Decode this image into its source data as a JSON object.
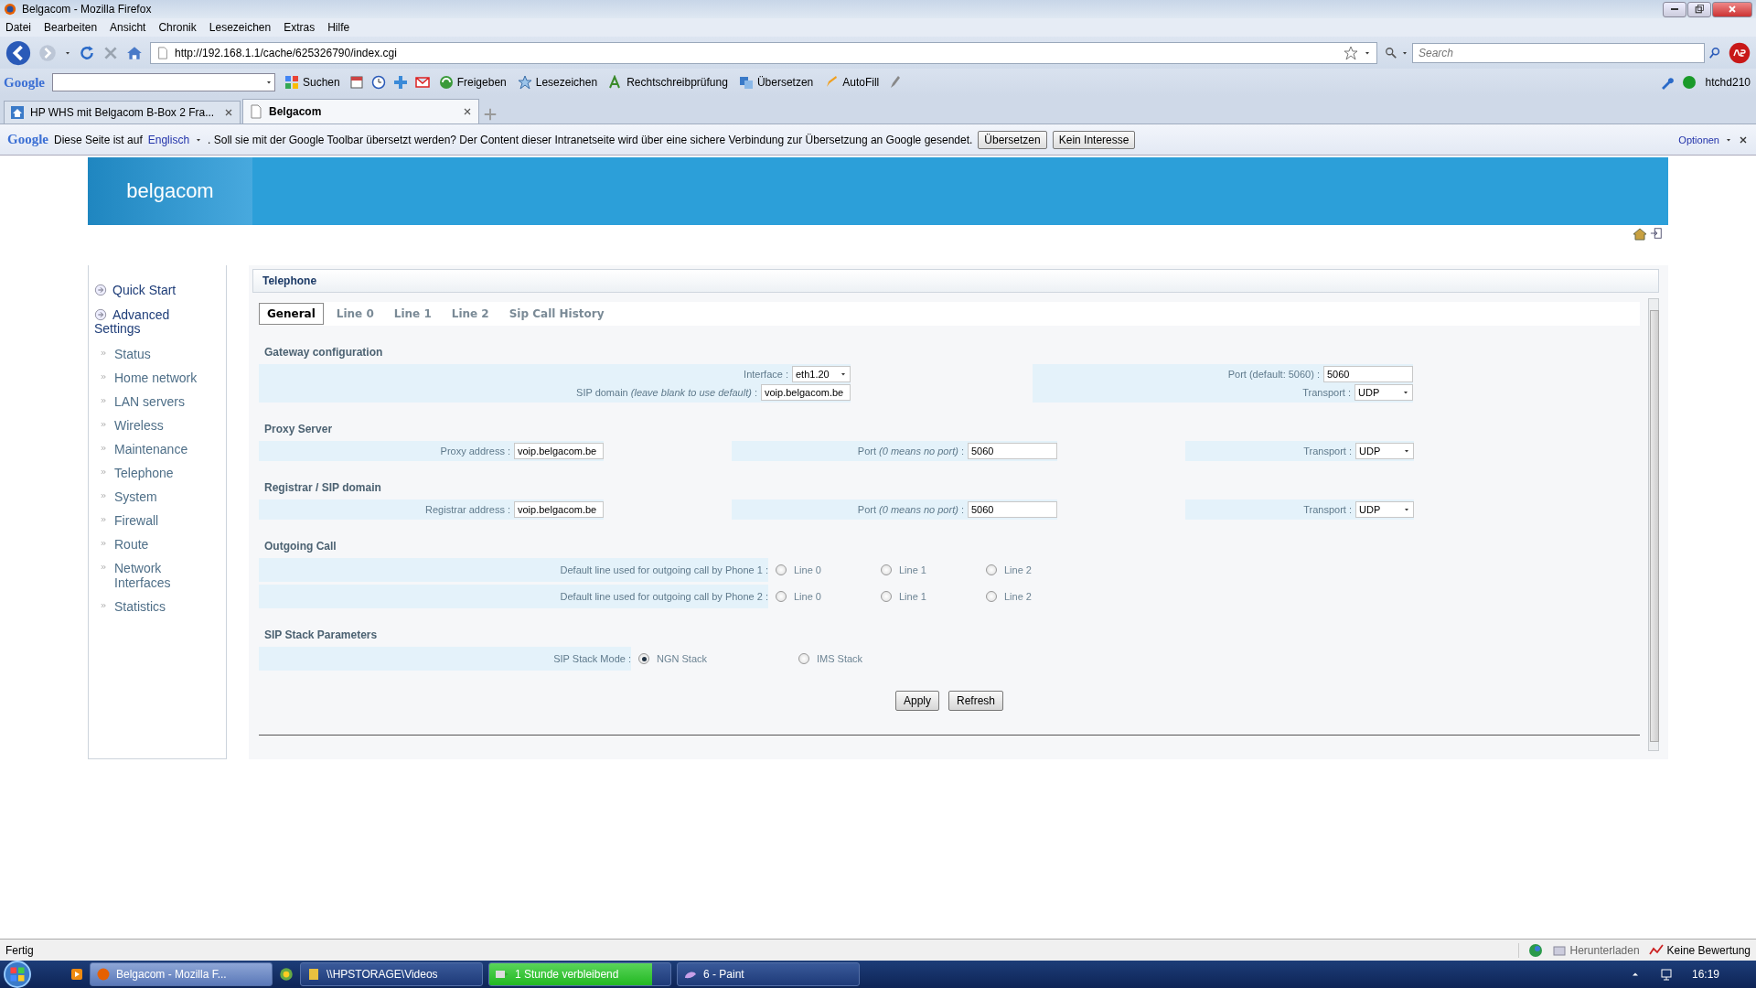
{
  "window": {
    "title": "Belgacom - Mozilla Firefox"
  },
  "menu": [
    "Datei",
    "Bearbeiten",
    "Ansicht",
    "Chronik",
    "Lesezeichen",
    "Extras",
    "Hilfe"
  ],
  "navbar": {
    "url": "http://192.168.1.1/cache/625326790/index.cgi",
    "search": {
      "placeholder": "Search"
    }
  },
  "google_toolbar": {
    "logo": "Google",
    "items": [
      "Suchen",
      "Freigeben",
      "Lesezeichen",
      "Rechtschreibprüfung",
      "Übersetzen",
      "AutoFill"
    ],
    "account": "htchd210"
  },
  "tabs": [
    {
      "label": "HP WHS mit Belgacom B-Box 2 Fra...",
      "selected": false
    },
    {
      "label": "Belgacom",
      "selected": true
    }
  ],
  "translate_bar": {
    "logo": "Google",
    "prefix": "Diese Seite ist auf",
    "language": "Englisch",
    "message": ". Soll sie mit der Google Toolbar übersetzt werden? Der Content dieser Intranetseite wird über eine sichere Verbindung zur Übersetzung an Google gesendet.",
    "buttons": [
      "Übersetzen",
      "Kein Interesse"
    ],
    "options": "Optionen"
  },
  "page": {
    "brand": "belgacom",
    "sidebar": [
      {
        "label": "Quick Start",
        "kind": "section"
      },
      {
        "label": "Advanced Settings",
        "kind": "section"
      },
      {
        "label": "Status",
        "kind": "link"
      },
      {
        "label": "Home network",
        "kind": "link"
      },
      {
        "label": "LAN servers",
        "kind": "link"
      },
      {
        "label": "Wireless",
        "kind": "link"
      },
      {
        "label": "Maintenance",
        "kind": "link"
      },
      {
        "label": "Telephone",
        "kind": "link"
      },
      {
        "label": "System",
        "kind": "link"
      },
      {
        "label": "Firewall",
        "kind": "link"
      },
      {
        "label": "Route",
        "kind": "link"
      },
      {
        "label": "Network Interfaces",
        "kind": "link"
      },
      {
        "label": "Statistics",
        "kind": "link"
      }
    ],
    "panel": {
      "title": "Telephone",
      "tabs": [
        {
          "label": "General",
          "selected": true
        },
        {
          "label": "Line 0",
          "selected": false
        },
        {
          "label": "Line 1",
          "selected": false
        },
        {
          "label": "Line 2",
          "selected": false
        },
        {
          "label": "Sip Call History",
          "selected": false
        }
      ],
      "sections": [
        {
          "title": "Gateway configuration",
          "kind": "columns",
          "columns": [
            [
              {
                "label": "Interface :",
                "kind": "select",
                "value": "eth1.20"
              },
              {
                "label": "SIP domain *(leave blank to use default)* :",
                "kind": "input",
                "value": "voip.belgacom.be"
              }
            ],
            [
              {
                "label": "Port (default: 5060) :",
                "kind": "input",
                "value": "5060"
              },
              {
                "label": "Transport :",
                "kind": "select",
                "value": "UDP"
              }
            ]
          ]
        },
        {
          "title": "Proxy Server",
          "kind": "row",
          "cells": [
            {
              "label": "Proxy address :",
              "kind": "input",
              "value": "voip.belgacom.be"
            },
            {
              "label": "Port *(0 means no port)* :",
              "kind": "input",
              "value": "5060"
            },
            {
              "label": "Transport :",
              "kind": "select",
              "value": "UDP"
            }
          ]
        },
        {
          "title": "Registrar / SIP domain",
          "kind": "row",
          "cells": [
            {
              "label": "Registrar address :",
              "kind": "input",
              "value": "voip.belgacom.be"
            },
            {
              "label": "Port *(0 means no port)* :",
              "kind": "input",
              "value": "5060"
            },
            {
              "label": "Transport :",
              "kind": "select",
              "value": "UDP"
            }
          ]
        },
        {
          "title": "Outgoing Call",
          "kind": "radios",
          "rows": [
            {
              "label": "Default line used for outgoing call by Phone 1 :",
              "options": [
                {
                  "label": "Line 0",
                  "selected": false
                },
                {
                  "label": "Line 1",
                  "selected": false
                },
                {
                  "label": "Line 2",
                  "selected": false
                }
              ]
            },
            {
              "label": "Default line used for outgoing call by Phone 2 :",
              "options": [
                {
                  "label": "Line 0",
                  "selected": false
                },
                {
                  "label": "Line 1",
                  "selected": false
                },
                {
                  "label": "Line 2",
                  "selected": false
                }
              ]
            }
          ]
        },
        {
          "title": "SIP Stack Parameters",
          "kind": "radios",
          "rows": [
            {
              "label": "SIP Stack Mode :",
              "options": [
                {
                  "label": "NGN Stack",
                  "selected": true
                },
                {
                  "label": "IMS Stack",
                  "selected": false
                }
              ]
            }
          ]
        }
      ],
      "buttons": [
        "Apply",
        "Refresh"
      ]
    }
  },
  "status_bar": {
    "text": "Fertig",
    "download": "Herunterladen",
    "rating": "Keine Bewertung"
  },
  "taskbar": {
    "buttons": [
      {
        "label": "Belgacom - Mozilla F...",
        "kind": "window",
        "selected": true
      },
      {
        "label": "\\\\HPSTORAGE\\Videos",
        "kind": "window",
        "selected": false
      },
      {
        "label": "1 Stunde verbleibend",
        "kind": "progress",
        "level": 0.9,
        "selected": false
      },
      {
        "label": "6 - Paint",
        "kind": "window",
        "selected": false
      }
    ],
    "clock": "16:19"
  }
}
